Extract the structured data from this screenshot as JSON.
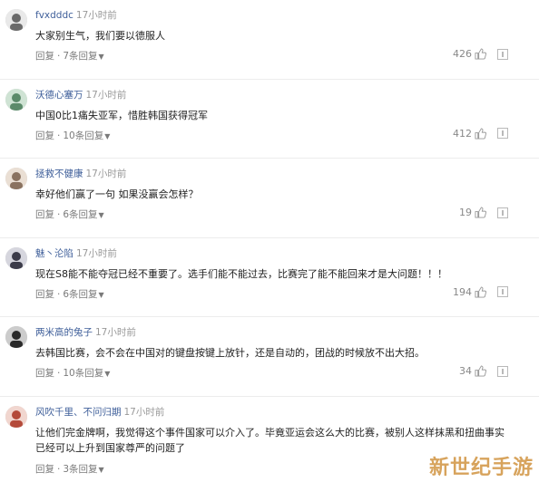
{
  "comments": [
    {
      "user": "fvxdddc",
      "time": "17小时前",
      "text": "大家别生气，我们要以德服人",
      "reply_label": "回复",
      "replies_label": "7条回复",
      "likes": "426",
      "avatar_color": "#6a6a6a"
    },
    {
      "user": "沃德心塞万",
      "time": "17小时前",
      "text": "中国0比1痛失亚军，惜胜韩国获得冠军",
      "reply_label": "回复",
      "replies_label": "10条回复",
      "likes": "412",
      "avatar_color": "#5b8a6a"
    },
    {
      "user": "拯救不健康",
      "time": "17小时前",
      "text": "幸好他们赢了一句 如果没赢会怎样？",
      "reply_label": "回复",
      "replies_label": "6条回复",
      "likes": "19",
      "avatar_color": "#8a7260"
    },
    {
      "user": "魅丶沦陷",
      "time": "17小时前",
      "text": "现在S8能不能夺冠已经不重要了。选手们能不能过去，比赛完了能不能回来才是大问题！！！",
      "reply_label": "回复",
      "replies_label": "6条回复",
      "likes": "194",
      "avatar_color": "#3c3c4a"
    },
    {
      "user": "两米高的兔子",
      "time": "17小时前",
      "text": "去韩国比赛，会不会在中国对的键盘按键上放针，还是自动的，团战的时候放不出大招。",
      "reply_label": "回复",
      "replies_label": "10条回复",
      "likes": "34",
      "avatar_color": "#2a2a2a"
    },
    {
      "user": "风吹千里、不问归期",
      "time": "17小时前",
      "text": "让他们完金牌啊，我觉得这个事件国家可以介入了。毕竟亚运会这么大的比赛，被别人这样抹黑和扭曲事实已经可以上升到国家尊严的问题了",
      "reply_label": "回复",
      "replies_label": "3条回复",
      "likes": "",
      "avatar_color": "#b44a3a"
    }
  ],
  "watermark": "新世纪手游"
}
